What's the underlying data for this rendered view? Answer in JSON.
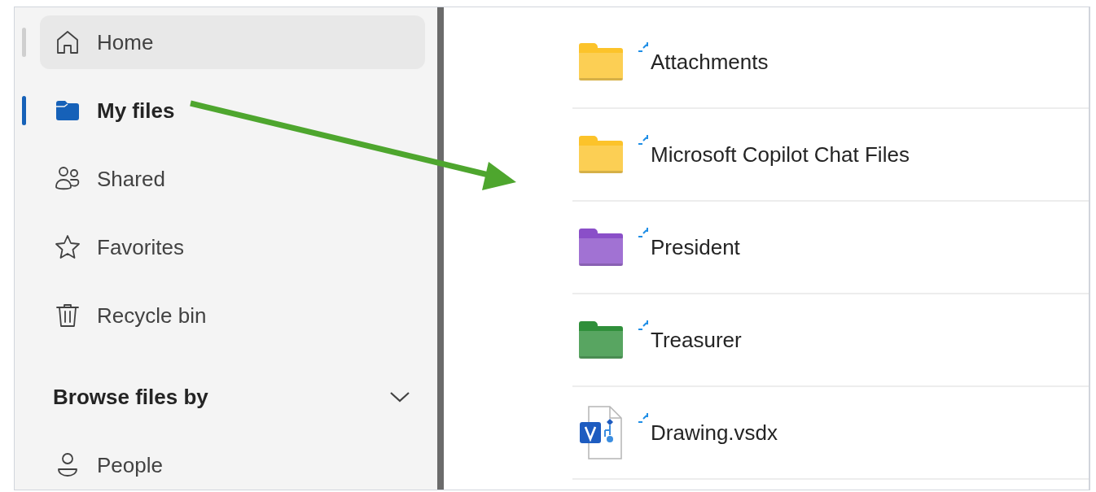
{
  "sidebar": {
    "items": [
      {
        "label": "Home",
        "kind": "home",
        "selected": false,
        "hovered": true
      },
      {
        "label": "My files",
        "kind": "folder",
        "selected": true,
        "hovered": false
      },
      {
        "label": "Shared",
        "kind": "shared",
        "selected": false,
        "hovered": false
      },
      {
        "label": "Favorites",
        "kind": "star",
        "selected": false,
        "hovered": false
      },
      {
        "label": "Recycle bin",
        "kind": "trash",
        "selected": false,
        "hovered": false
      }
    ],
    "section": {
      "title": "Browse files by",
      "expanded": true,
      "items": [
        {
          "label": "People",
          "kind": "person"
        }
      ]
    }
  },
  "files": [
    {
      "name": "Attachments",
      "kind": "folder",
      "color": "#fcc32a",
      "new": true
    },
    {
      "name": "Microsoft Copilot Chat Files",
      "kind": "folder",
      "color": "#fcc32a",
      "new": true
    },
    {
      "name": "President",
      "kind": "folder",
      "color": "#8a4fc8",
      "new": true
    },
    {
      "name": "Treasurer",
      "kind": "folder",
      "color": "#2f8f3a",
      "new": true
    },
    {
      "name": "Drawing.vsdx",
      "kind": "visio",
      "new": true
    }
  ]
}
